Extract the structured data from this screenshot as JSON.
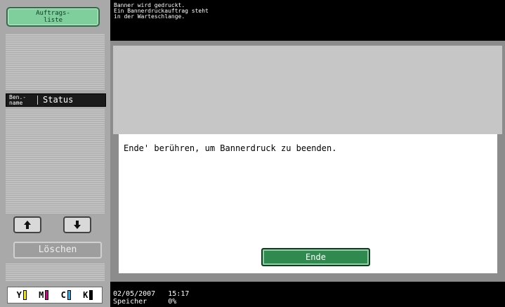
{
  "left_panel": {
    "jobs_button": {
      "line1": "Auftrags-",
      "line2": "liste"
    },
    "list_header": {
      "name_line1": "Ben.-",
      "name_line2": "name",
      "status": "Status"
    },
    "delete_button": "Löschen",
    "toner": [
      {
        "letter": "Y",
        "color": "#f2e600"
      },
      {
        "letter": "M",
        "color": "#d0008a"
      },
      {
        "letter": "C",
        "color": "#19b4e6"
      },
      {
        "letter": "K",
        "color": "#000000"
      }
    ]
  },
  "message": {
    "line1": "Banner wird gedruckt.",
    "line2": "Ein Bannerdruckauftrag steht",
    "line3": "in der Warteschlange."
  },
  "main": {
    "instruction": "Ende' berühren, um Bannerdruck zu beenden.",
    "end_button": "Ende"
  },
  "status_bar": {
    "date": "02/05/2007",
    "time": "15:17",
    "memory_label": "Speicher",
    "memory_value": "0%"
  },
  "colors": {
    "accent_green": "#2f8a4f",
    "jobs_green": "#7fcf9c"
  }
}
